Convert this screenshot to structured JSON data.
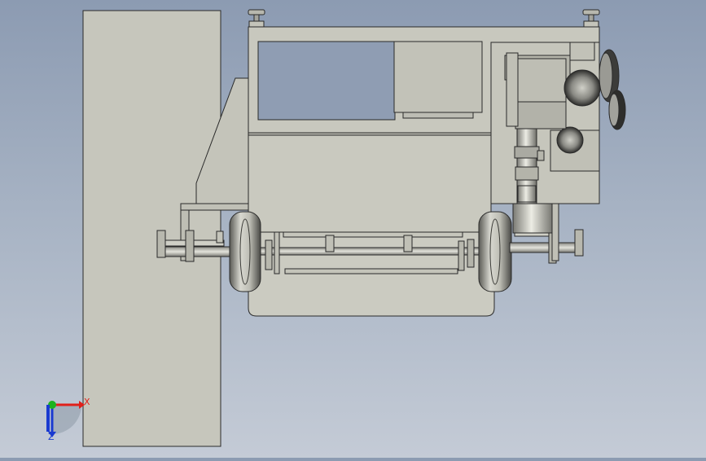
{
  "viewport": {
    "background_top": "#8c9bb2",
    "background_bottom": "#c4cbd6",
    "model_fill": "#c8c8be",
    "model_stroke": "#2a2a2a"
  },
  "triad": {
    "x_label": "X",
    "z_label": "Z",
    "x_color": "#e0201a",
    "y_color": "#1db31d",
    "z_color": "#1a3ad0"
  }
}
